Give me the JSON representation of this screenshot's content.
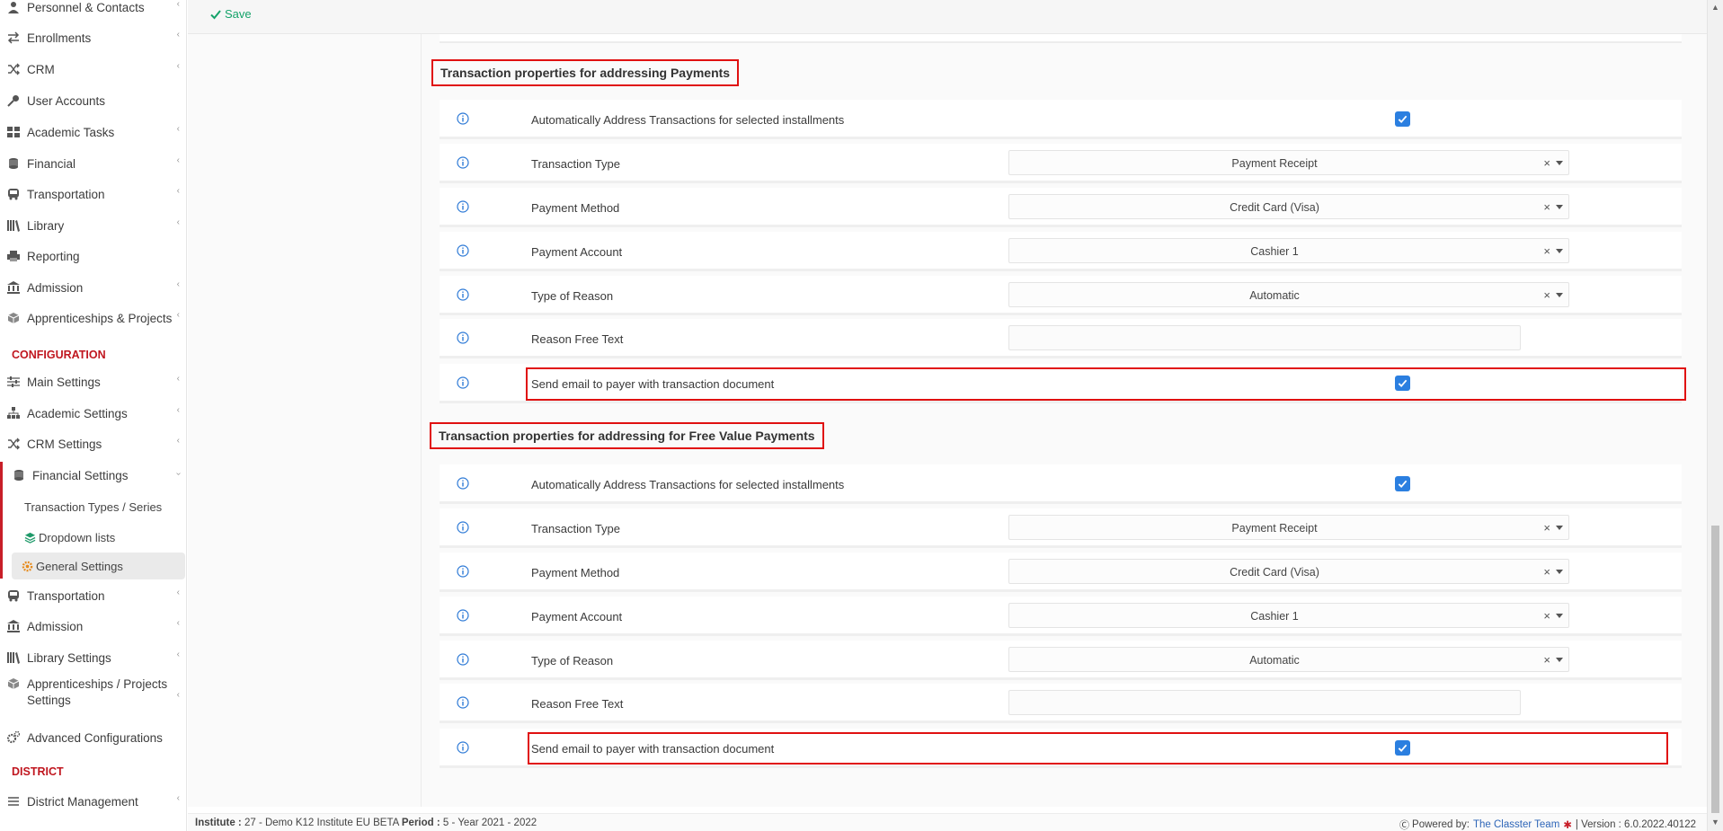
{
  "sidebar": {
    "items": [
      {
        "label": "Personnel & Contacts",
        "icon": "users-icon",
        "chevron": true
      },
      {
        "label": "Enrollments",
        "icon": "exchange-icon",
        "chevron": true
      },
      {
        "label": "CRM",
        "icon": "shuffle-icon",
        "chevron": true
      },
      {
        "label": "User Accounts",
        "icon": "key-icon",
        "chevron": false
      },
      {
        "label": "Academic Tasks",
        "icon": "grid-icon",
        "chevron": true
      },
      {
        "label": "Financial",
        "icon": "coins-icon",
        "chevron": true
      },
      {
        "label": "Transportation",
        "icon": "bus-icon",
        "chevron": true
      },
      {
        "label": "Library",
        "icon": "books-icon",
        "chevron": true
      },
      {
        "label": "Reporting",
        "icon": "printer-icon",
        "chevron": false
      },
      {
        "label": "Admission",
        "icon": "bank-icon",
        "chevron": true
      },
      {
        "label": "Apprenticeships & Projects",
        "icon": "cube-icon",
        "chevron": true
      }
    ],
    "config_section": "CONFIGURATION",
    "config_items": [
      {
        "label": "Main Settings",
        "icon": "sliders-icon",
        "chevron": true
      },
      {
        "label": "Academic Settings",
        "icon": "org-icon",
        "chevron": true
      },
      {
        "label": "CRM Settings",
        "icon": "shuffle-icon",
        "chevron": true
      },
      {
        "label": "Financial Settings",
        "icon": "coins-icon",
        "chevron": true
      }
    ],
    "financial_sub": [
      {
        "label": "Transaction Types / Series"
      },
      {
        "label": "Dropdown lists",
        "icon": "layers-icon"
      },
      {
        "label": "General Settings",
        "icon": "gear-icon",
        "active": true
      }
    ],
    "config_items_2": [
      {
        "label": "Transportation",
        "icon": "bus-icon",
        "chevron": true
      },
      {
        "label": "Admission",
        "icon": "bank-icon",
        "chevron": true
      },
      {
        "label": "Library Settings",
        "icon": "books-icon",
        "chevron": true
      },
      {
        "label": "Apprenticeships / Projects Settings",
        "icon": "cube-icon",
        "chevron": true
      },
      {
        "label": "Advanced Configurations",
        "icon": "cogs-icon",
        "chevron": false
      }
    ],
    "district_section": "DISTRICT",
    "district_items": [
      {
        "label": "District Management",
        "icon": "list-icon",
        "chevron": true
      }
    ]
  },
  "toolbar": {
    "save_label": "Save"
  },
  "section1": {
    "title": "Transaction properties for addressing Payments",
    "rows": [
      {
        "label": "Automatically Address Transactions for selected installments",
        "type": "checkbox",
        "checked": true
      },
      {
        "label": "Transaction Type",
        "type": "select",
        "value": "Payment Receipt"
      },
      {
        "label": "Payment Method",
        "type": "select",
        "value": "Credit Card (Visa)"
      },
      {
        "label": "Payment Account",
        "type": "select",
        "value": "Cashier 1"
      },
      {
        "label": "Type of Reason",
        "type": "select",
        "value": "Automatic"
      },
      {
        "label": "Reason Free Text",
        "type": "text",
        "value": ""
      },
      {
        "label": "Send email to payer with transaction document",
        "type": "checkbox",
        "checked": true
      }
    ]
  },
  "section2": {
    "title": "Transaction properties for addressing for Free Value Payments",
    "rows": [
      {
        "label": "Automatically Address Transactions for selected installments",
        "type": "checkbox",
        "checked": true
      },
      {
        "label": "Transaction Type",
        "type": "select",
        "value": "Payment Receipt"
      },
      {
        "label": "Payment Method",
        "type": "select",
        "value": "Credit Card (Visa)"
      },
      {
        "label": "Payment Account",
        "type": "select",
        "value": "Cashier 1"
      },
      {
        "label": "Type of Reason",
        "type": "select",
        "value": "Automatic"
      },
      {
        "label": "Reason Free Text",
        "type": "text",
        "value": ""
      },
      {
        "label": "Send email to payer with transaction document",
        "type": "checkbox",
        "checked": true
      }
    ]
  },
  "footer": {
    "institute_label": "Institute :",
    "institute_value": "27 - Demo K12 Institute EU BETA",
    "period_label": "Period :",
    "period_value": "5 - Year 2021 - 2022",
    "powered_label": "Powered by:",
    "powered_link": "The Classter Team",
    "version": "| Version : 6.0.2022.40122"
  },
  "colors": {
    "accent": "#c81e28",
    "checkbox": "#2b7fe0",
    "highlight": "#e01010",
    "save": "#15a36a"
  }
}
